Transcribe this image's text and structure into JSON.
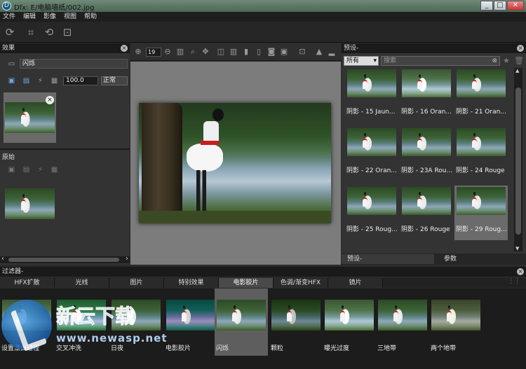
{
  "window": {
    "title": "Dfx: E/电脑墙纸/002.jpg",
    "app_icon": "dfx-app-icon"
  },
  "menu": [
    "文件",
    "编辑",
    "影像",
    "视图",
    "帮助"
  ],
  "effects_panel": {
    "title": "效果",
    "effect_name": "闪烁",
    "strength": "100.0",
    "blend_mode": "正常",
    "original_title": "原始"
  },
  "preview": {
    "zoom": "19"
  },
  "presets_panel": {
    "title": "预设-",
    "category": "所有",
    "search_placeholder": "搜索",
    "items": [
      "阴影 - 15 Jaun...",
      "阴影 - 16 Oran...",
      "阴影 - 21 Oran...",
      "阴影 - 22 Oran...",
      "阴影 - 23A Rou...",
      "阴影 - 24 Rouge",
      "阴影 - 25 Roug...",
      "阴影 - 26 Rouge",
      "阴影 - 29 Roug..."
    ],
    "footer_tabs": [
      "预设-",
      "参数"
    ]
  },
  "filters": {
    "title": "过滤器-",
    "tabs": [
      "HFX扩散",
      "光线",
      "图片",
      "特别效果",
      "电影胶片",
      "色调/渐变HFX",
      "镜片"
    ],
    "active_tab": "电影胶片",
    "items": [
      "设置漂白过程",
      "交叉冲洗",
      "日夜",
      "电影胶片",
      "闪烁",
      "颗粒",
      "曝光过度",
      "三地带",
      "两个地带"
    ],
    "selected": "闪烁"
  },
  "watermark": {
    "name": "新云下载",
    "url": "www.newasp.net"
  }
}
